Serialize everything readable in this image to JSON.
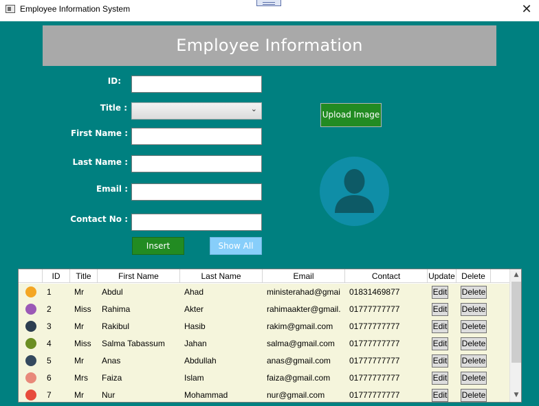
{
  "window": {
    "title": "Employee Information System",
    "close_glyph": "✕"
  },
  "header": {
    "title": "Employee Information"
  },
  "form": {
    "id_label": "ID:",
    "title_label": "Title :",
    "first_name_label": "First Name :",
    "last_name_label": "Last Name :",
    "email_label": "Email :",
    "contact_label": "Contact No :",
    "id_value": "",
    "title_value": "",
    "first_name_value": "",
    "last_name_value": "",
    "email_value": "",
    "contact_value": "",
    "chevron": "⌄"
  },
  "buttons": {
    "insert": "Insert",
    "show_all": "Show All",
    "upload_image": "Upload Image"
  },
  "grid": {
    "columns": [
      "ID",
      "Title",
      "First Name",
      "Last Name",
      "Email",
      "Contact",
      "Update",
      "Delete"
    ],
    "edit_label": "Edit",
    "delete_label": "Delete",
    "scroll_up": "▲",
    "scroll_down": "▼",
    "rows": [
      {
        "id": "1",
        "title": "Mr",
        "first": "Abdul",
        "last": "Ahad",
        "email": "ministerahad@gmail.com",
        "contact": "01831469877",
        "avatar_color": "#f4a623"
      },
      {
        "id": "2",
        "title": "Miss",
        "first": "Rahima",
        "last": "Akter",
        "email": "rahimaakter@gmail.com",
        "contact": "01777777777",
        "avatar_color": "#9b59b6"
      },
      {
        "id": "3",
        "title": "Mr",
        "first": "Rakibul",
        "last": "Hasib",
        "email": "rakim@gmail.com",
        "contact": "01777777777",
        "avatar_color": "#2c3e50"
      },
      {
        "id": "4",
        "title": "Miss",
        "first": "Salma Tabassum",
        "last": "Jahan",
        "email": "salma@gmail.com",
        "contact": "01777777777",
        "avatar_color": "#6b8e23"
      },
      {
        "id": "5",
        "title": "Mr",
        "first": "Anas",
        "last": "Abdullah",
        "email": "anas@gmail.com",
        "contact": "01777777777",
        "avatar_color": "#34495e"
      },
      {
        "id": "6",
        "title": "Mrs",
        "first": "Faiza",
        "last": "Islam",
        "email": "faiza@gmail.com",
        "contact": "01777777777",
        "avatar_color": "#e8897a"
      },
      {
        "id": "7",
        "title": "Mr",
        "first": "Nur",
        "last": "Mohammad",
        "email": "nur@gmail.com",
        "contact": "01777777777",
        "avatar_color": "#e74c3c"
      }
    ]
  },
  "colors": {
    "background": "#008080",
    "header": "#a9a9a9",
    "insert": "#228b22",
    "show_all": "#87cefa",
    "upload": "#228b22",
    "avatar_bg": "#0f8ea7",
    "avatar_fg": "#0d5a66",
    "grid_rows": "#f5f5dc"
  }
}
